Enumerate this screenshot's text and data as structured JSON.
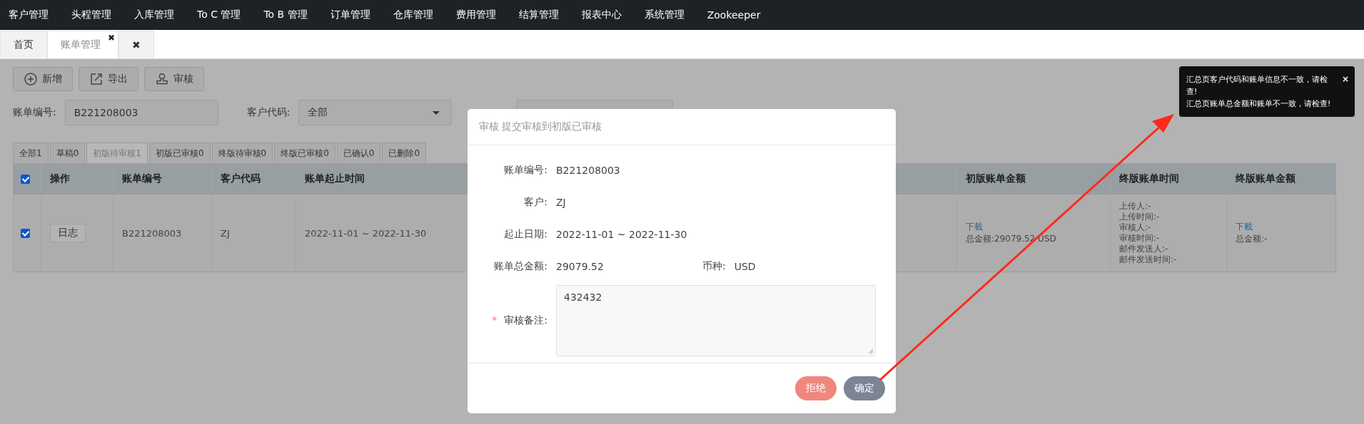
{
  "nav": {
    "items": [
      "客户管理",
      "头程管理",
      "入库管理",
      "To C 管理",
      "To B 管理",
      "订单管理",
      "仓库管理",
      "费用管理",
      "结算管理",
      "报表中心",
      "系统管理",
      "Zookeeper"
    ]
  },
  "page_tabs": [
    {
      "label": "首页",
      "selected": false,
      "closable": false
    },
    {
      "label": "账单管理",
      "selected": true,
      "closable": true
    },
    {
      "label": "✖",
      "selected": false,
      "closable": false
    }
  ],
  "close_glyph": "✖",
  "toolbar": [
    {
      "label": "新增",
      "kind": "add"
    },
    {
      "label": "导出",
      "kind": "export"
    },
    {
      "label": "审核",
      "kind": "audit"
    }
  ],
  "filters": {
    "bill_no": {
      "label": "账单编号:",
      "value": "B221208003"
    },
    "customer": {
      "label": "客户代码:",
      "value": "全部"
    }
  },
  "status_tabs": [
    {
      "label": "全部1",
      "selected": false
    },
    {
      "label": "草稿0",
      "selected": false
    },
    {
      "label": "初版待审核1",
      "selected": true
    },
    {
      "label": "初版已审核0",
      "selected": false
    },
    {
      "label": "终版待审核0",
      "selected": false
    },
    {
      "label": "终版已审核0",
      "selected": false
    },
    {
      "label": "已确认0",
      "selected": false
    },
    {
      "label": "已删除0",
      "selected": false
    }
  ],
  "table": {
    "all_checked": true,
    "columns_left": [
      "操作",
      "账单编号",
      "客户代码",
      "账单起止时间"
    ],
    "columns_right": [
      "初版账单金额",
      "终版账单时间",
      "终版账单金额"
    ],
    "rows": [
      {
        "checked": true,
        "action": "日志",
        "bill_no": "B221208003",
        "customer": "ZJ",
        "period": "2022-11-01 ~ 2022-11-30",
        "first_link": "下載",
        "first_total": "总金额:29079.52 USD",
        "final_time": [
          "上传人:-",
          "上传时间:-",
          "审核人:-",
          "审核时间:-",
          "邮件发送人:-",
          "邮件发送时间:-"
        ],
        "final_link": "下載",
        "final_total": "总金额:-"
      }
    ]
  },
  "dialog": {
    "title": "审核 提交审核到初版已审核",
    "fields": [
      {
        "label": "账单编号:",
        "value": "B221208003"
      },
      {
        "label": "客户:",
        "value": "ZJ"
      },
      {
        "label": "起止日期:",
        "value": "2022-11-01 ~ 2022-11-30"
      }
    ],
    "amount": {
      "label": "账单总金额:",
      "value": "29079.52"
    },
    "currency": {
      "label": "币种:",
      "value": "USD"
    },
    "remark": {
      "required_mark": "*",
      "label": "审核备注:",
      "value": "432432"
    },
    "buttons": [
      {
        "label": "拒绝",
        "kind": "reject"
      },
      {
        "label": "确定",
        "kind": "confirm"
      }
    ]
  },
  "toast": {
    "messages": [
      "汇总页客户代码和账单信息不一致，请检查!",
      "汇总页账单总金额和账单不一致，请检查!"
    ],
    "close": "×"
  }
}
